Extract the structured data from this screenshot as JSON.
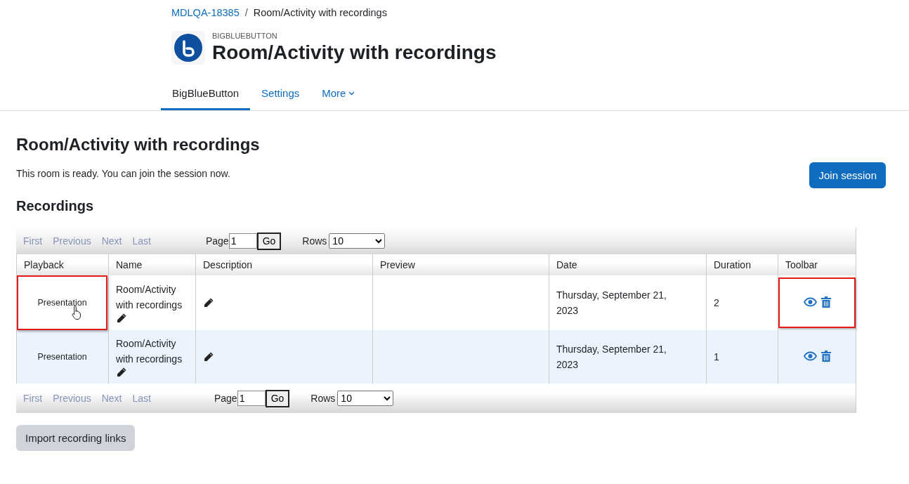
{
  "breadcrumb": {
    "separator": "/",
    "items": [
      {
        "label": "MDLQA-18385",
        "link": true
      },
      {
        "label": "Room/Activity with recordings",
        "link": false
      }
    ]
  },
  "activity": {
    "type_label": "BIGBLUEBUTTON",
    "title": "Room/Activity with recordings"
  },
  "tabs": [
    {
      "label": "BigBlueButton",
      "selected": true,
      "dropdown": false
    },
    {
      "label": "Settings",
      "selected": false,
      "dropdown": false
    },
    {
      "label": "More",
      "selected": false,
      "dropdown": true
    }
  ],
  "heading": "Room/Activity with recordings",
  "status_message": "This room is ready. You can join the session now.",
  "join_button": "Join session",
  "recordings_heading": "Recordings",
  "pagination_top": {
    "links": [
      {
        "label": "First",
        "disabled": true
      },
      {
        "label": "Previous",
        "disabled": true
      },
      {
        "label": "Next",
        "disabled": true
      },
      {
        "label": "Last",
        "disabled": true
      }
    ],
    "page_label": "Page",
    "page_value": "1",
    "go": "Go",
    "rows_label": "Rows",
    "rows_value": "10"
  },
  "table": {
    "columns": [
      "Playback",
      "Name",
      "Description",
      "Preview",
      "Date",
      "Duration",
      "Toolbar"
    ],
    "rows": [
      {
        "playback": "Presentation",
        "name": "Room/Activity with recordings",
        "date": "Thursday, September 21, 2023",
        "duration": "2",
        "highlighted": true,
        "cursor": true
      },
      {
        "playback": "Presentation",
        "name": "Room/Activity with recordings",
        "date": "Thursday, September 21, 2023",
        "duration": "1",
        "highlighted": false,
        "cursor": false
      }
    ]
  },
  "pagination_bottom": {
    "links": [
      {
        "label": "First",
        "disabled": true
      },
      {
        "label": "Previous",
        "disabled": true
      },
      {
        "label": "Next",
        "disabled": true
      },
      {
        "label": "Last",
        "disabled": true
      }
    ],
    "page_label": "Page",
    "page_value": "1",
    "go": "Go",
    "rows_label": "Rows",
    "rows_value": "10"
  },
  "import_button": "Import recording links"
}
